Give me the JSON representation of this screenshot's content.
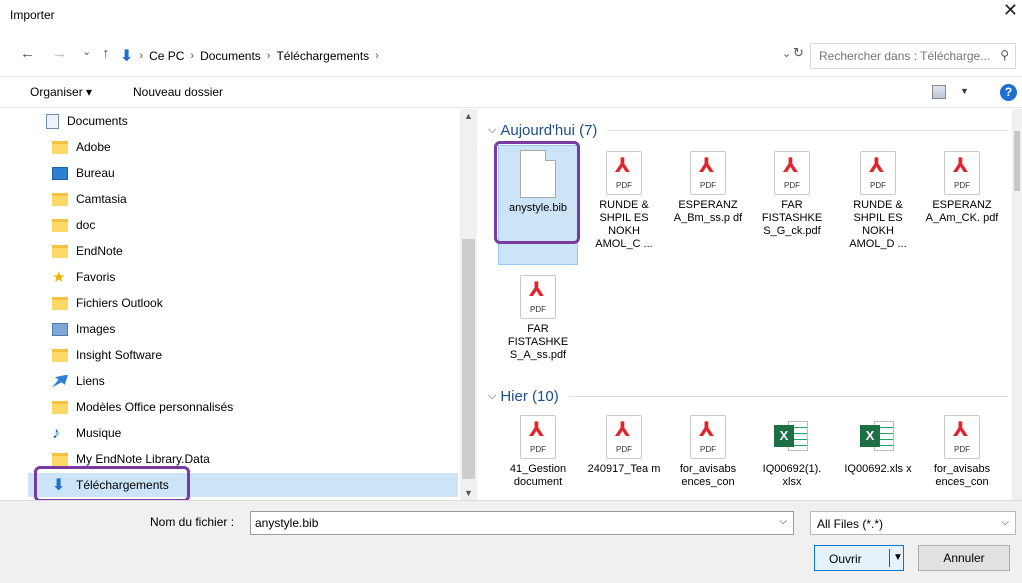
{
  "window": {
    "title": "Importer",
    "close_glyph": "✕"
  },
  "address": {
    "back": "←",
    "forward": "→",
    "recent": "⌄",
    "up": "↑",
    "crumbs": [
      "Ce PC",
      "Documents",
      "Téléchargements"
    ],
    "sep": "›",
    "refresh": "↻",
    "search_placeholder": "Rechercher dans : Télécharge..."
  },
  "toolbar": {
    "organize": "Organiser ▾",
    "new_folder": "Nouveau dossier",
    "help": "?"
  },
  "sidebar": {
    "items": [
      {
        "label": "Documents",
        "icon": "document-icon"
      },
      {
        "label": "Adobe",
        "icon": "folder-icon"
      },
      {
        "label": "Bureau",
        "icon": "desktop-icon"
      },
      {
        "label": "Camtasia",
        "icon": "folder-icon"
      },
      {
        "label": "doc",
        "icon": "folder-icon"
      },
      {
        "label": "EndNote",
        "icon": "folder-icon"
      },
      {
        "label": "Favoris",
        "icon": "star-icon"
      },
      {
        "label": "Fichiers Outlook",
        "icon": "folder-icon"
      },
      {
        "label": "Images",
        "icon": "images-icon"
      },
      {
        "label": "Insight Software",
        "icon": "folder-icon"
      },
      {
        "label": "Liens",
        "icon": "link-icon"
      },
      {
        "label": "Modèles Office personnalisés",
        "icon": "folder-icon"
      },
      {
        "label": "Musique",
        "icon": "music-icon"
      },
      {
        "label": "My EndNote Library.Data",
        "icon": "folder-icon"
      },
      {
        "label": "Téléchargements",
        "icon": "download-icon"
      }
    ]
  },
  "groups": {
    "today": "Aujourd'hui (7)",
    "yesterday": "Hier (10)"
  },
  "files_today": [
    {
      "name": "anystyle.bib",
      "type": "blank"
    },
    {
      "name": "RUNDE & SHPIL ES NOKH AMOL_C ...",
      "type": "pdf"
    },
    {
      "name": "ESPERANZ A_Bm_ss.p df",
      "type": "pdf"
    },
    {
      "name": "FAR FISTASHKE S_G_ck.pdf",
      "type": "pdf"
    },
    {
      "name": "RUNDE & SHPIL ES NOKH AMOL_D ...",
      "type": "pdf"
    },
    {
      "name": "ESPERANZ A_Am_CK. pdf",
      "type": "pdf"
    },
    {
      "name": "FAR FISTASHKE S_A_ss.pdf",
      "type": "pdf"
    }
  ],
  "files_yesterday": [
    {
      "name": "41_Gestion document",
      "type": "pdf"
    },
    {
      "name": "240917_Tea m",
      "type": "pdf"
    },
    {
      "name": "for_avisabs ences_con",
      "type": "pdf"
    },
    {
      "name": "IQ00692(1). xlsx",
      "type": "xls"
    },
    {
      "name": "IQ00692.xls x",
      "type": "xls"
    },
    {
      "name": "for_avisabs ences_con",
      "type": "pdf"
    }
  ],
  "icons": {
    "pdf_tag": "PDF",
    "acrobat": "⅄",
    "excel": "X"
  },
  "bottom": {
    "filename_label": "Nom du fichier :",
    "filename_value": "anystyle.bib",
    "filetype": "All Files (*.*)",
    "open": "Ouvrir",
    "cancel": "Annuler"
  },
  "colors": {
    "highlight": "#7a3aa0",
    "selection": "#cce4f7",
    "pdf_red": "#e0262a"
  }
}
